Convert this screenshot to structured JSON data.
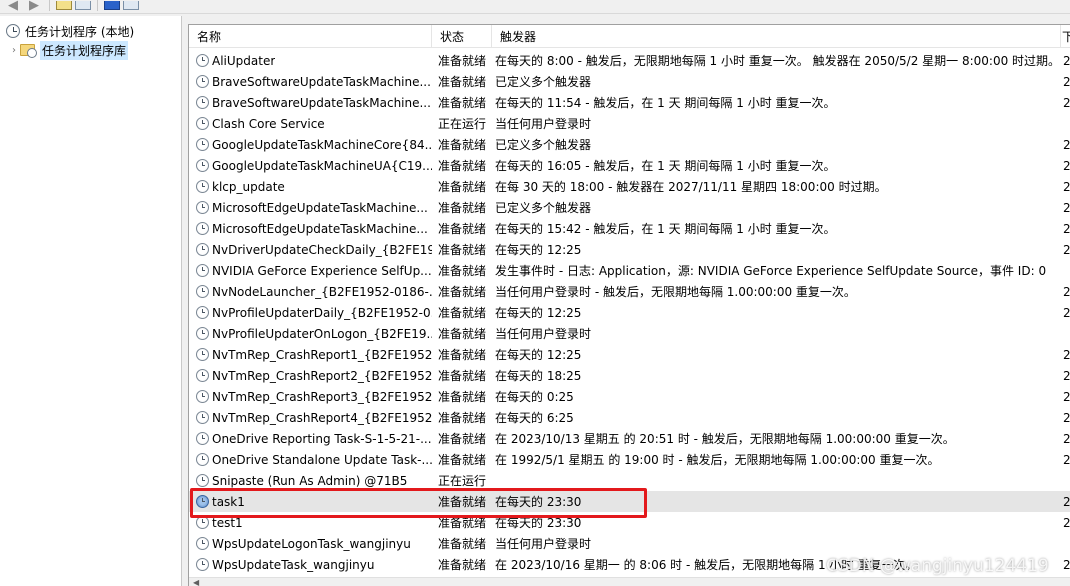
{
  "toolbar": {
    "buttons": [
      "back-arrow-icon",
      "forward-arrow-icon",
      "properties-icon",
      "show-hide-pane-icon",
      "help-icon",
      "action-pane-icon"
    ]
  },
  "tree": {
    "root_label": "任务计划程序 (本地)",
    "child_label": "任务计划程序库"
  },
  "columns": {
    "name": "名称",
    "status": "状态",
    "trigger": "触发器",
    "next": "下"
  },
  "tasks": [
    {
      "name": "AliUpdater",
      "status": "准备就绪",
      "trigger": "在每天的 8:00 - 触发后，无限期地每隔 1 小时 重复一次。 触发器在 2050/5/2 星期一 8:00:00 时过期。",
      "next": "2"
    },
    {
      "name": "BraveSoftwareUpdateTaskMachine...",
      "status": "准备就绪",
      "trigger": "已定义多个触发器",
      "next": "2"
    },
    {
      "name": "BraveSoftwareUpdateTaskMachine...",
      "status": "准备就绪",
      "trigger": "在每天的 11:54 - 触发后，在 1 天 期间每隔 1 小时 重复一次。",
      "next": "2"
    },
    {
      "name": "Clash Core Service",
      "status": "正在运行",
      "trigger": "当任何用户登录时",
      "next": ""
    },
    {
      "name": "GoogleUpdateTaskMachineCore{84...",
      "status": "准备就绪",
      "trigger": "已定义多个触发器",
      "next": "2"
    },
    {
      "name": "GoogleUpdateTaskMachineUA{C19...",
      "status": "准备就绪",
      "trigger": "在每天的 16:05 - 触发后，在 1 天 期间每隔 1 小时 重复一次。",
      "next": "2"
    },
    {
      "name": "klcp_update",
      "status": "准备就绪",
      "trigger": "在每 30 天的 18:00 - 触发器在 2027/11/11 星期四 18:00:00 时过期。",
      "next": "2"
    },
    {
      "name": "MicrosoftEdgeUpdateTaskMachine...",
      "status": "准备就绪",
      "trigger": "已定义多个触发器",
      "next": "2"
    },
    {
      "name": "MicrosoftEdgeUpdateTaskMachine...",
      "status": "准备就绪",
      "trigger": "在每天的 15:42 - 触发后，在 1 天 期间每隔 1 小时 重复一次。",
      "next": "2"
    },
    {
      "name": "NvDriverUpdateCheckDaily_{B2FE19...",
      "status": "准备就绪",
      "trigger": "在每天的 12:25",
      "next": "2"
    },
    {
      "name": "NVIDIA GeForce Experience SelfUp...",
      "status": "准备就绪",
      "trigger": "发生事件时 - 日志: Application，源: NVIDIA GeForce Experience SelfUpdate Source，事件 ID: 0",
      "next": ""
    },
    {
      "name": "NvNodeLauncher_{B2FE1952-0186-...",
      "status": "准备就绪",
      "trigger": "当任何用户登录时 - 触发后，无限期地每隔 1.00:00:00 重复一次。",
      "next": "2"
    },
    {
      "name": "NvProfileUpdaterDaily_{B2FE1952-0...",
      "status": "准备就绪",
      "trigger": "在每天的 12:25",
      "next": "2"
    },
    {
      "name": "NvProfileUpdaterOnLogon_{B2FE19...",
      "status": "准备就绪",
      "trigger": "当任何用户登录时",
      "next": ""
    },
    {
      "name": "NvTmRep_CrashReport1_{B2FE1952...",
      "status": "准备就绪",
      "trigger": "在每天的 12:25",
      "next": "2"
    },
    {
      "name": "NvTmRep_CrashReport2_{B2FE1952...",
      "status": "准备就绪",
      "trigger": "在每天的 18:25",
      "next": "2"
    },
    {
      "name": "NvTmRep_CrashReport3_{B2FE1952...",
      "status": "准备就绪",
      "trigger": "在每天的 0:25",
      "next": "2"
    },
    {
      "name": "NvTmRep_CrashReport4_{B2FE1952...",
      "status": "准备就绪",
      "trigger": "在每天的 6:25",
      "next": "2"
    },
    {
      "name": "OneDrive Reporting Task-S-1-5-21-...",
      "status": "准备就绪",
      "trigger": "在 2023/10/13 星期五 的 20:51 时 - 触发后，无限期地每隔 1.00:00:00 重复一次。",
      "next": "2"
    },
    {
      "name": "OneDrive Standalone Update Task-...",
      "status": "准备就绪",
      "trigger": "在 1992/5/1 星期五 的 19:00 时 - 触发后，无限期地每隔 1.00:00:00 重复一次。",
      "next": "2"
    },
    {
      "name": "Snipaste (Run As Admin) @71B5",
      "status": "正在运行",
      "trigger": "",
      "next": ""
    },
    {
      "name": "task1",
      "status": "准备就绪",
      "trigger": "在每天的 23:30",
      "next": "2",
      "selected": true
    },
    {
      "name": "test1",
      "status": "准备就绪",
      "trigger": "在每天的 23:30",
      "next": "2"
    },
    {
      "name": "WpsUpdateLogonTask_wangjinyu",
      "status": "准备就绪",
      "trigger": "当任何用户登录时",
      "next": ""
    },
    {
      "name": "WpsUpdateTask_wangjinyu",
      "status": "准备就绪",
      "trigger": "在 2023/10/16 星期一 的 8:06 时 - 触发后，无限期地每隔 1 小时 重复一次。",
      "next": "2"
    }
  ],
  "watermark": "CSDN @wangjinyu124419",
  "colors": {
    "highlight_box": "#e3191c",
    "selected_row": "#e5e5e5",
    "tree_selected": "#cce8ff"
  }
}
